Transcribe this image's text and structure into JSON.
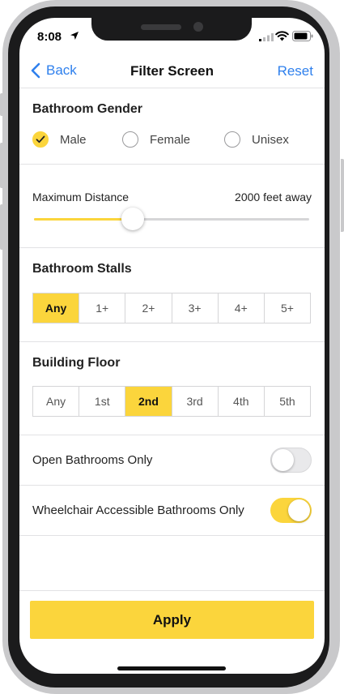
{
  "status_bar": {
    "time": "8:08"
  },
  "nav": {
    "back_label": "Back",
    "title": "Filter Screen",
    "reset_label": "Reset"
  },
  "gender": {
    "title": "Bathroom Gender",
    "options": [
      {
        "label": "Male",
        "selected": true
      },
      {
        "label": "Female",
        "selected": false
      },
      {
        "label": "Unisex",
        "selected": false
      }
    ]
  },
  "distance": {
    "label": "Maximum Distance",
    "value_text": "2000 feet away",
    "fraction": 0.36
  },
  "stalls": {
    "title": "Bathroom Stalls",
    "options": [
      "Any",
      "1+",
      "2+",
      "3+",
      "4+",
      "5+"
    ],
    "selected": "Any"
  },
  "floor": {
    "title": "Building Floor",
    "options": [
      "Any",
      "1st",
      "2nd",
      "3rd",
      "4th",
      "5th"
    ],
    "selected": "2nd"
  },
  "toggles": [
    {
      "label": "Open Bathrooms Only",
      "on": false
    },
    {
      "label": "Wheelchair Accessible Bathrooms Only",
      "on": true
    }
  ],
  "apply_label": "Apply",
  "colors": {
    "accent": "#fbd53c",
    "link": "#2f80ed"
  }
}
